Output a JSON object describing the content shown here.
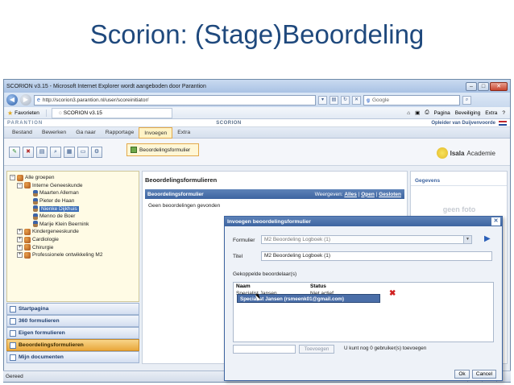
{
  "slide": {
    "title": "Scorion: (Stage)Beoordeling"
  },
  "browser": {
    "window_title": "SCORION v3.15 - Microsoft Internet Explorer wordt aangeboden door Parantion",
    "url": "http://scorion3.parantion.nl/user/scoreinitiator/",
    "search_placeholder": "Google",
    "search_logo": "g",
    "favorites_label": "Favorieten",
    "tab_title": "SCORION v3.15",
    "tools": {
      "page": "Pagina",
      "security": "Beveiliging",
      "extra": "Extra"
    },
    "status": "Gereed"
  },
  "app": {
    "brand": "PARANTION",
    "center_title": "SCORION",
    "user": "Opleider van Duijvenvoorde",
    "menu": [
      "Bestand",
      "Bewerken",
      "Ga naar",
      "Rapportage",
      "Invoegen",
      "Extra"
    ],
    "dropdown_item": "Beoordelingsformulier",
    "institution_bold": "Isala",
    "institution_rest": "Academie"
  },
  "tree": {
    "items": [
      {
        "label": "Alle groepen",
        "level": 0,
        "type": "group",
        "exp": "−"
      },
      {
        "label": "Interne Geneeskunde",
        "level": 1,
        "type": "group",
        "exp": "−"
      },
      {
        "label": "Maarten Alleman",
        "level": 2,
        "type": "person"
      },
      {
        "label": "Pieter de Haan",
        "level": 2,
        "type": "person"
      },
      {
        "label": "Nienke Dijkhuis",
        "level": 2,
        "type": "person",
        "selected": true
      },
      {
        "label": "Menno de Boer",
        "level": 2,
        "type": "person"
      },
      {
        "label": "Marije Klein Beernink",
        "level": 2,
        "type": "person"
      },
      {
        "label": "Kindergeneeskunde",
        "level": 1,
        "type": "group",
        "exp": "+"
      },
      {
        "label": "Cardiologie",
        "level": 1,
        "type": "group",
        "exp": "+"
      },
      {
        "label": "Chirurgie",
        "level": 1,
        "type": "group",
        "exp": "+"
      },
      {
        "label": "Professionele ontwikkeling M2",
        "level": 1,
        "type": "group",
        "exp": "+"
      }
    ]
  },
  "leftnav": [
    {
      "label": "Startpagina",
      "active": false
    },
    {
      "label": "360 formulieren",
      "active": false
    },
    {
      "label": "Eigen formulieren",
      "active": false
    },
    {
      "label": "Beoordelingsformulieren",
      "active": true
    },
    {
      "label": "Mijn documenten",
      "active": false
    }
  ],
  "main": {
    "title": "Beoordelingsformulieren",
    "header_label": "Beoordelingsformulier",
    "views_label": "Weergeven:",
    "view_all": "Alles",
    "view_open": "Open",
    "view_closed": "Gesloten",
    "view_sep": "|",
    "empty_text": "Geen beoordelingen gevonden"
  },
  "right": {
    "title": "Gegevens",
    "photo_placeholder": "geen foto"
  },
  "dialog": {
    "title": "Invoegen beoordelingsformulier",
    "form_label": "Formulier",
    "form_value": "M2 Beoordeling Logboek (1)",
    "title_label": "Titel",
    "title_value": "M2 Beoordeling Logboek (1)",
    "linked_label": "Gekoppelde beoordelaar(s)",
    "col_name": "Naam",
    "col_status": "Status",
    "reviewer_name": "Specialist Jansen",
    "reviewer_status": "Niet actief",
    "tooltip": "Specialist Jansen (rsmeenk01@gmail.com)",
    "add_button": "Toevoegen",
    "add_info": "U kunt nog 0 gebruiker(s) toevoegen",
    "ok": "Ok",
    "cancel": "Cancel"
  }
}
